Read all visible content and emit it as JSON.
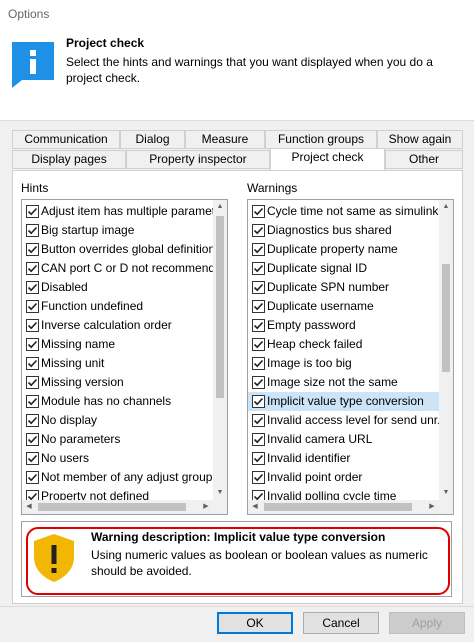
{
  "window": {
    "title": "Options"
  },
  "header": {
    "icon": "info-icon",
    "title": "Project check",
    "description": "Select the hints and warnings that you want displayed when you do a project check."
  },
  "tabs": {
    "row1": [
      "Communication",
      "Dialog",
      "Measure",
      "Function groups",
      "Show again"
    ],
    "row2": [
      "Display pages",
      "Property inspector",
      "Project check",
      "Other"
    ],
    "active": "Project check"
  },
  "hints": {
    "label": "Hints",
    "items": [
      "Adjust item has multiple parameters",
      "Big startup image",
      "Button overrides global definition",
      "CAN port C or D not recommended",
      "Disabled",
      "Function undefined",
      "Inverse calculation order",
      "Missing name",
      "Missing unit",
      "Missing version",
      "Module has no channels",
      "No display",
      "No parameters",
      "No users",
      "Not member of any adjust group",
      "Property not defined"
    ]
  },
  "warnings": {
    "label": "Warnings",
    "selected": "Implicit value type conversion",
    "items": [
      "Cycle time not same as simulink",
      "Diagnostics bus shared",
      "Duplicate property name",
      "Duplicate signal ID",
      "Duplicate SPN number",
      "Duplicate username",
      "Empty password",
      "Heap check failed",
      "Image is too big",
      "Image size not the same",
      "Implicit value type conversion",
      "Invalid access level for send unr.",
      "Invalid camera URL",
      "Invalid identifier",
      "Invalid point order",
      "Invalid polling cycle time"
    ]
  },
  "description_box": {
    "icon": "warning-shield-icon",
    "title": "Warning description: Implicit value type conversion",
    "text": "Using numeric values as boolean or boolean values as numeric should be avoided.",
    "highlight_color": "#e00000"
  },
  "buttons": {
    "ok": "OK",
    "cancel": "Cancel",
    "apply": "Apply"
  }
}
